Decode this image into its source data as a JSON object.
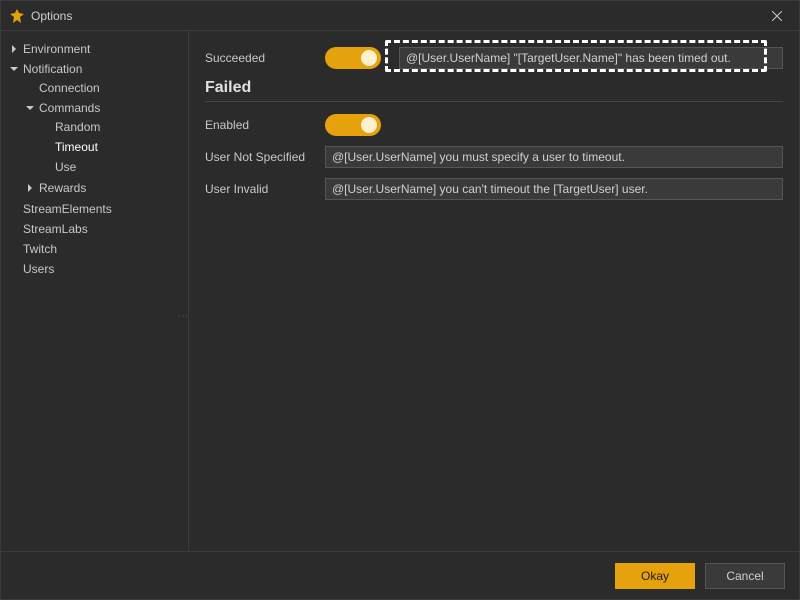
{
  "window": {
    "title": "Options"
  },
  "sidebar": {
    "items": [
      {
        "label": "Environment",
        "expandable": true,
        "expanded": false
      },
      {
        "label": "Notification",
        "expandable": true,
        "expanded": true,
        "children": [
          {
            "label": "Connection"
          },
          {
            "label": "Commands",
            "expandable": true,
            "expanded": true,
            "children": [
              {
                "label": "Random"
              },
              {
                "label": "Timeout",
                "selected": true
              },
              {
                "label": "Use"
              }
            ]
          },
          {
            "label": "Rewards",
            "expandable": true,
            "expanded": false
          }
        ]
      },
      {
        "label": "StreamElements"
      },
      {
        "label": "StreamLabs"
      },
      {
        "label": "Twitch"
      },
      {
        "label": "Users"
      }
    ]
  },
  "content": {
    "succeeded": {
      "label": "Succeeded",
      "toggle_on": true,
      "value": "@[User.UserName] \"[TargetUser.Name]\" has been timed out."
    },
    "failed_section": "Failed",
    "enabled": {
      "label": "Enabled",
      "toggle_on": true
    },
    "user_not_specified": {
      "label": "User Not Specified",
      "value": "@[User.UserName] you must specify a user to timeout."
    },
    "user_invalid": {
      "label": "User Invalid",
      "value": "@[User.UserName] you can't timeout the [TargetUser] user."
    }
  },
  "footer": {
    "ok_label": "Okay",
    "cancel_label": "Cancel"
  },
  "colors": {
    "accent": "#e6a20d"
  }
}
